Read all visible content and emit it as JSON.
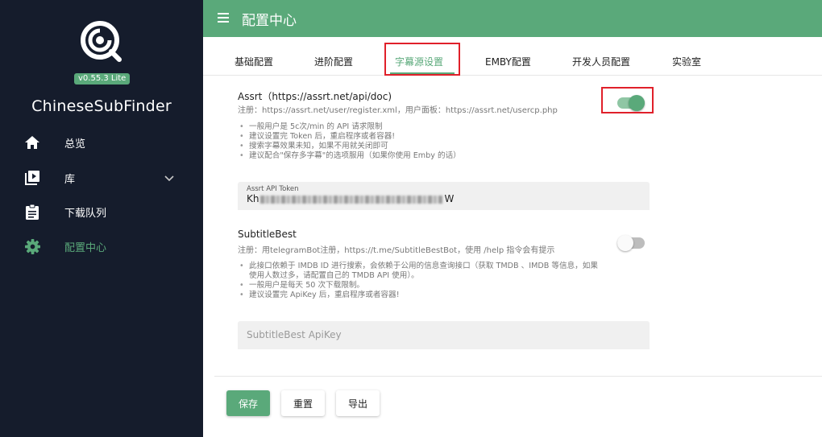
{
  "colors": {
    "accent": "#5aa97a",
    "sidebar_bg": "#151c2c",
    "highlight": "#e0202a"
  },
  "sidebar": {
    "version": "v0.55.3 Lite",
    "app_name": "ChineseSubFinder",
    "items": [
      {
        "label": "总览",
        "icon": "home-icon"
      },
      {
        "label": "库",
        "icon": "video-library-icon"
      },
      {
        "label": "下载队列",
        "icon": "clipboard-icon"
      },
      {
        "label": "配置中心",
        "icon": "gear-icon",
        "active": true
      }
    ]
  },
  "header": {
    "title": "配置中心"
  },
  "tabs": [
    "基础配置",
    "进阶配置",
    "字幕源设置",
    "EMBY配置",
    "开发人员配置",
    "实验室"
  ],
  "assrt": {
    "title": "Assrt（https://assrt.net/api/doc)",
    "hint": "注册：https://assrt.net/user/register.xml，用户面板：https://assrt.net/usercp.php",
    "enabled": true,
    "bullets": [
      "一般用户是 5c次/min 的 API 请求限制",
      "建议设置完 Token 后，重启程序或者容器!",
      "搜索字幕效果未知，如果不用就关闭即可",
      "建议配合\"保存多字幕\"的选项服用（如果你使用 Emby 的话）"
    ],
    "token_label": "Assrt API Token",
    "token_prefix": "Kh",
    "token_suffix": "W"
  },
  "subtitlebest": {
    "title": "SubtitleBest",
    "hint": "注册：用telegramBot注册，https://t.me/SubtitleBestBot，使用 /help 指令会有提示",
    "enabled": false,
    "bullets": [
      "此接口依赖于 IMDB ID 进行搜索，会依赖于公用的信息查询接口（获取 TMDB 、IMDB 等信息，如果使用人数过多，请配置自己的 TMDB API 使用）。",
      "一般用户是每天 50 次下载限制。",
      "建议设置完 ApiKey 后，重启程序或者容器!"
    ],
    "apikey_placeholder": "SubtitleBest ApiKey"
  },
  "actions": {
    "save": "保存",
    "reset": "重置",
    "export": "导出"
  }
}
